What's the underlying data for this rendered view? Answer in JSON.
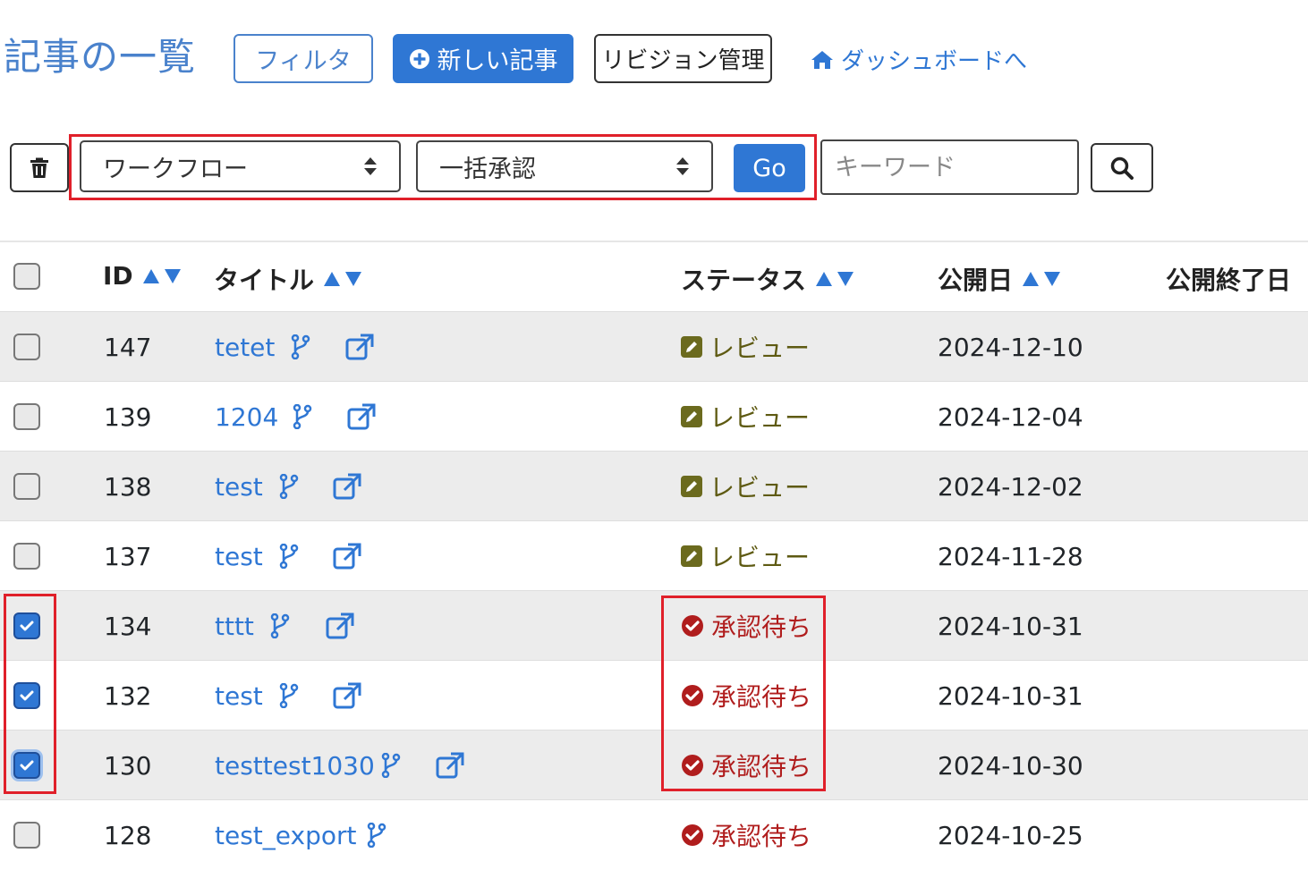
{
  "header": {
    "title": "記事の一覧",
    "filter_label": "フィルタ",
    "new_article_label": "新しい記事",
    "revision_label": "リビジョン管理",
    "dashboard_label": "ダッシュボードへ"
  },
  "toolbar": {
    "workflow_select": "ワークフロー",
    "action_select": "一括承認",
    "go_label": "Go",
    "keyword_placeholder": "キーワード"
  },
  "table": {
    "columns": [
      "ID",
      "タイトル",
      "ステータス",
      "公開日",
      "公開終了日"
    ],
    "rows": [
      {
        "id": "147",
        "title": "tetet",
        "status": "レビュー",
        "status_type": "review",
        "date": "2024-12-10",
        "checked": false
      },
      {
        "id": "139",
        "title": "1204",
        "status": "レビュー",
        "status_type": "review",
        "date": "2024-12-04",
        "checked": false
      },
      {
        "id": "138",
        "title": "test",
        "status": "レビュー",
        "status_type": "review",
        "date": "2024-12-02",
        "checked": false
      },
      {
        "id": "137",
        "title": "test",
        "status": "レビュー",
        "status_type": "review",
        "date": "2024-11-28",
        "checked": false
      },
      {
        "id": "134",
        "title": "tttt",
        "status": "承認待ち",
        "status_type": "pending",
        "date": "2024-10-31",
        "checked": true
      },
      {
        "id": "132",
        "title": "test",
        "status": "承認待ち",
        "status_type": "pending",
        "date": "2024-10-31",
        "checked": true
      },
      {
        "id": "130",
        "title": "testtest1030",
        "status": "承認待ち",
        "status_type": "pending",
        "date": "2024-10-30",
        "checked": true
      },
      {
        "id": "128",
        "title": "test_export",
        "status": "承認待ち",
        "status_type": "pending",
        "date": "2024-10-25",
        "checked": false
      }
    ]
  },
  "colors": {
    "accent": "#2f77d4",
    "highlight_box": "#e0202a",
    "review_status": "#5e5a12",
    "pending_status": "#b01d1d"
  },
  "icons": [
    "plus-circle-icon",
    "home-icon",
    "trash-icon",
    "search-icon",
    "sort-asc-icon",
    "sort-desc-icon",
    "branch-icon",
    "external-link-icon",
    "edit-icon",
    "check-circle-icon",
    "checkmark-icon"
  ]
}
